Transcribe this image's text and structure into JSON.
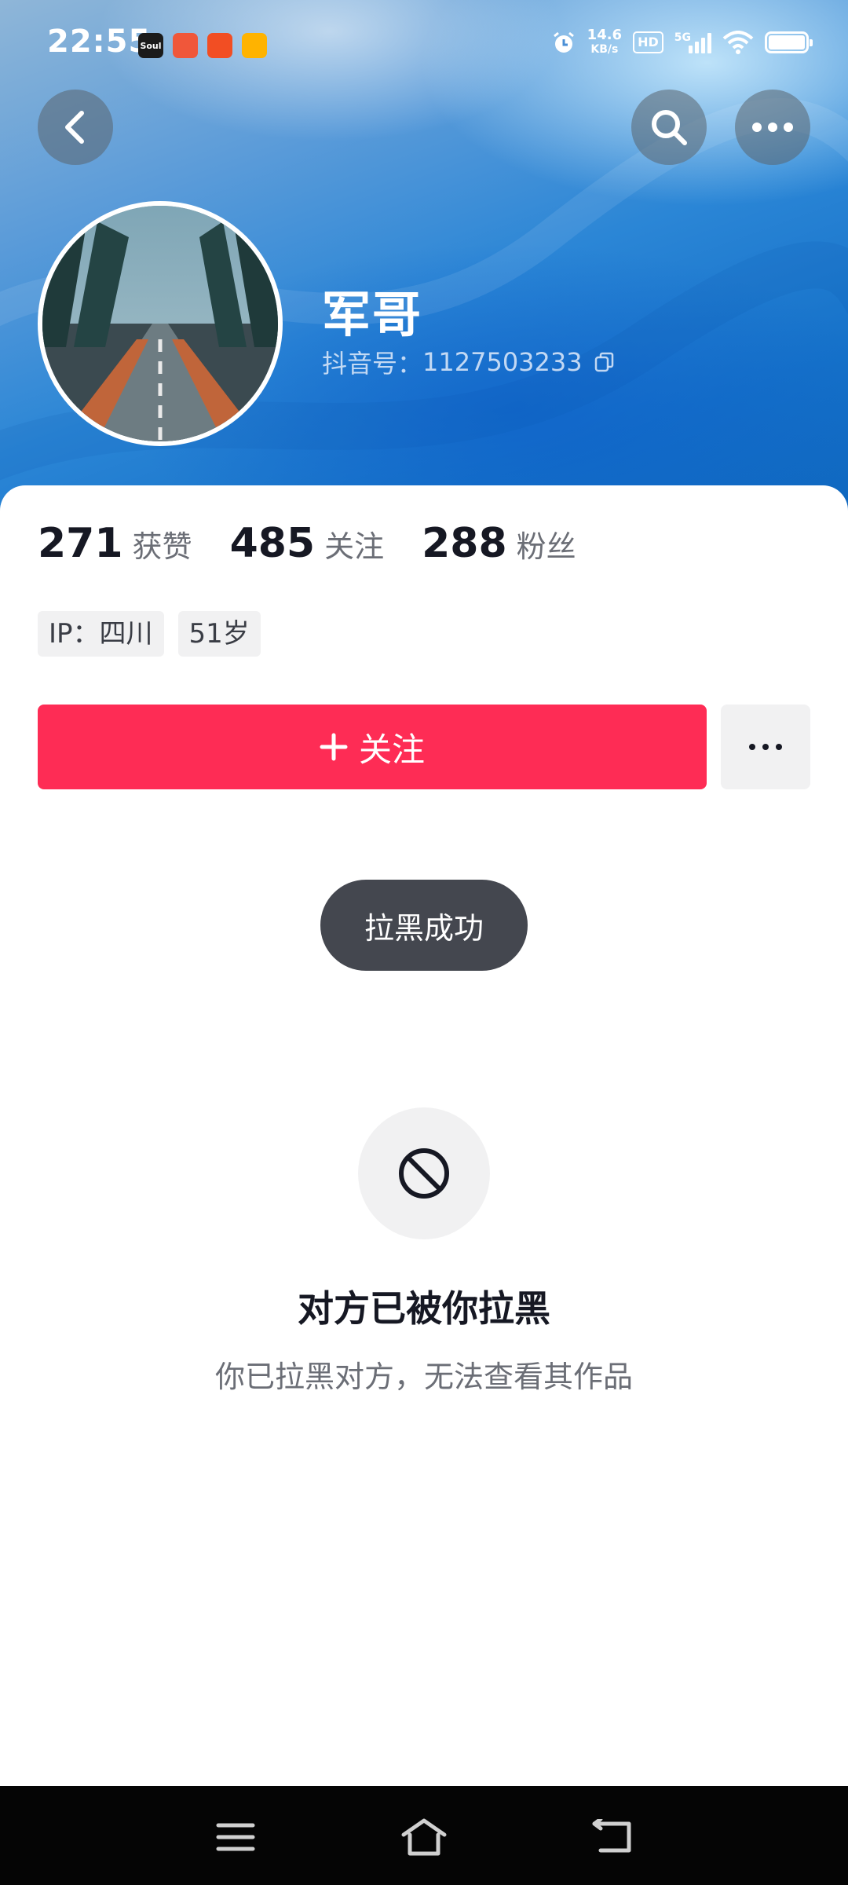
{
  "status_bar": {
    "time": "22:55",
    "app_icons": [
      {
        "name": "soul-app-icon",
        "label": "Soul",
        "color": "#1b1b1b"
      },
      {
        "name": "app-icon-2",
        "label": "",
        "color": "#f0573a"
      },
      {
        "name": "app-icon-3",
        "label": "",
        "color": "#f24e23"
      },
      {
        "name": "app-icon-4",
        "label": "",
        "color": "#ffb300"
      }
    ],
    "net_speed_value": "14.6",
    "net_speed_unit": "KB/s",
    "hd_label": "HD",
    "signal_label": "5G"
  },
  "profile": {
    "nickname": "军哥",
    "douyin_id_label": "抖音号：",
    "douyin_id": "1127503233"
  },
  "stats": [
    {
      "num": "271",
      "label": "获赞"
    },
    {
      "num": "485",
      "label": "关注"
    },
    {
      "num": "288",
      "label": "粉丝"
    }
  ],
  "tags": [
    "IP：四川",
    "51岁"
  ],
  "actions": {
    "follow_plus": "+",
    "follow_label": "关注"
  },
  "toast": "拉黑成功",
  "blocked": {
    "title": "对方已被你拉黑",
    "desc": "你已拉黑对方，无法查看其作品"
  },
  "icons": {
    "back": "chevron-left-icon",
    "search": "search-icon",
    "more": "more-dots-icon",
    "copy": "copy-icon",
    "blocked": "block-icon",
    "nav_menu": "menu-icon",
    "nav_home": "home-icon",
    "nav_back": "back-arrow-icon"
  }
}
